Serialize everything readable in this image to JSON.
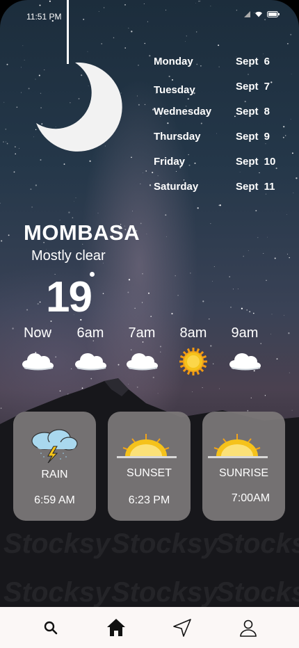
{
  "status_bar": {
    "time": "11:51 PM"
  },
  "forecast_days": [
    {
      "day": "Monday",
      "date": "Sept 6"
    },
    {
      "day": "Tuesday",
      "date": "Sept 7"
    },
    {
      "day": "Wednesday",
      "date": "Sept 8"
    },
    {
      "day": "Thursday",
      "date": "Sept 9"
    },
    {
      "day": "Friday",
      "date": "Sept 10"
    },
    {
      "day": "Saturday",
      "date": "Sept 11"
    }
  ],
  "location": {
    "city": "MOMBASA",
    "condition": "Mostly clear",
    "temperature": "19"
  },
  "hourly": [
    {
      "label": "Now",
      "icon": "cloud-icon"
    },
    {
      "label": "6am",
      "icon": "cloud-icon"
    },
    {
      "label": "7am",
      "icon": "cloud-icon"
    },
    {
      "label": "8am",
      "icon": "sun-icon"
    },
    {
      "label": "9am",
      "icon": "cloud-icon"
    }
  ],
  "cards": {
    "rain": {
      "title": "RAIN",
      "value": "6:59 AM",
      "icon": "storm-cloud-icon"
    },
    "sunset": {
      "title": "SUNSET",
      "value": "6:23 PM",
      "icon": "sunset-icon"
    },
    "sunrise": {
      "title": "SUNRISE",
      "value": "7:00AM",
      "icon": "sunrise-icon"
    }
  },
  "nav": [
    "search-icon",
    "home-icon",
    "navigation-arrow-icon",
    "profile-icon"
  ],
  "colors": {
    "card_bg": "#7d7979",
    "nav_bg": "#fbf7f6",
    "sun": "#f5c21b"
  }
}
